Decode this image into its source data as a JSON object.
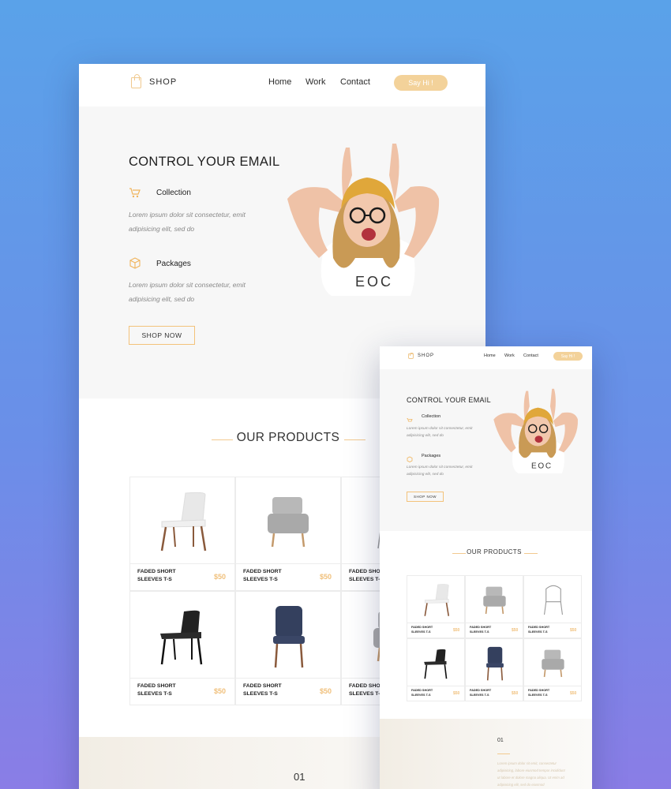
{
  "header": {
    "brand": "SHOP",
    "nav": [
      "Home",
      "Work",
      "Contact"
    ],
    "cta_label": "Say Hi !"
  },
  "hero": {
    "title": "CONTROL YOUR EMAIL",
    "features": [
      {
        "icon": "cart-icon",
        "label": "Collection",
        "desc_line1": "Lorem ipsum dolor sit consectetur, emit",
        "desc_line2": "adipisicing elit, sed do"
      },
      {
        "icon": "package-icon",
        "label": "Packages",
        "desc_line1": "Lorem ipsum dolor sit consectetur, emit",
        "desc_line2": "adipisicing elit, sed do"
      }
    ],
    "button_label": "SHOP NOW",
    "shirt_text": "EOC"
  },
  "products": {
    "title": "OUR PRODUCTS",
    "items": [
      {
        "name_line1": "FADED SHORT",
        "name_line2": "SLEEVES T-S",
        "price": "$50",
        "chair": "white-chair"
      },
      {
        "name_line1": "FADED SHORT",
        "name_line2": "SLEEVES T-S",
        "price": "$50",
        "chair": "gray-armchair"
      },
      {
        "name_line1": "FADED SHORT",
        "name_line2": "SLEEVES T-S",
        "price": "$50",
        "chair": "wire-chair"
      },
      {
        "name_line1": "FADED SHORT",
        "name_line2": "SLEEVES T-S",
        "price": "$50",
        "chair": "black-chair"
      },
      {
        "name_line1": "FADED SHORT",
        "name_line2": "SLEEVES T-S",
        "price": "$50",
        "chair": "navy-chair"
      },
      {
        "name_line1": "FADED SHORT",
        "name_line2": "SLEEVES T-S",
        "price": "$50",
        "chair": "gray-armchair"
      }
    ]
  },
  "footer": {
    "number": "01",
    "text_lines": [
      "Lorem ipsum dolor sit emit, consectetur",
      "adipisicing, labore eiusmod tempor incididunt",
      "ut labore et dolore magna aliqua. Ut enim ad",
      "adipisicing elit, sed do eiusmod"
    ]
  },
  "colors": {
    "accent": "#f3d29a",
    "hero_bg": "#f7f7f7",
    "page_bg_top": "#5aa2e9",
    "page_bg_bottom": "#8a7de6"
  }
}
